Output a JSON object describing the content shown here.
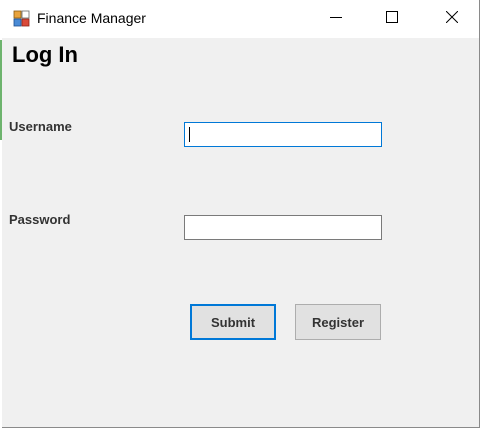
{
  "window": {
    "title": "Finance Manager",
    "controls": {
      "minimize": "minimize-icon",
      "maximize": "maximize-icon",
      "close": "close-icon"
    }
  },
  "form": {
    "heading": "Log In",
    "username_label": "Username",
    "username_value": "",
    "password_label": "Password",
    "password_value": "",
    "submit_label": "Submit",
    "register_label": "Register"
  },
  "colors": {
    "focus_border": "#0078d7",
    "background": "#f0f0f0",
    "button_face": "#e1e1e1"
  }
}
